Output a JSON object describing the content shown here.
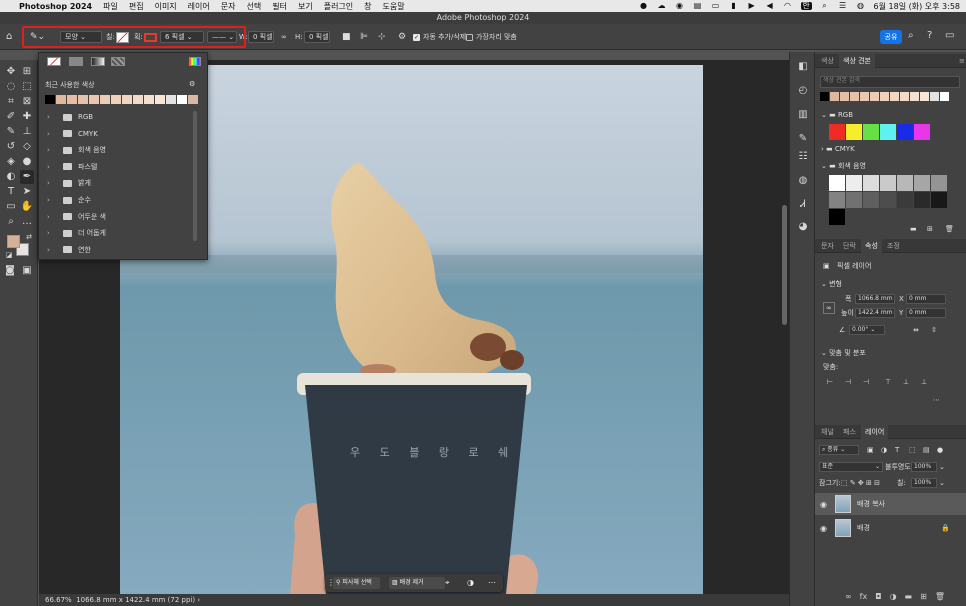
{
  "menubar": {
    "app_name": "Photoshop 2024",
    "items": [
      "파일",
      "편집",
      "이미지",
      "레이어",
      "문자",
      "선택",
      "필터",
      "보기",
      "플러그인",
      "창",
      "도움말"
    ],
    "datetime": "6월 18일 (화) 오후 3:58",
    "input_source": "한"
  },
  "window": {
    "title": "Adobe Photoshop 2024"
  },
  "options": {
    "mode_select": "모양",
    "fill_label": "칠:",
    "stroke_label": "획:",
    "stroke_width": "6 픽셀",
    "w_label": "W:",
    "w_value": "0 픽셀",
    "h_label": "H:",
    "h_value": "0 픽셀",
    "auto_add_delete": "자동 추가/삭제",
    "align_edges": "가장자리 맞춤",
    "share_button": "공유",
    "fill_color": "#ffffff",
    "stroke_color": "#e8392f"
  },
  "swatch_popup": {
    "recent_label": "최근 사용한 색상",
    "recent_colors": [
      "#000000",
      "#e0b8a0",
      "#e4bda4",
      "#e7c2aa",
      "#eac7b0",
      "#edccb6",
      "#efd1bc",
      "#f1d6c2",
      "#f3dbc9",
      "#f5e0cf",
      "#f7e5d6",
      "#e3e3e3",
      "#ffffff",
      "#d8b7a3"
    ],
    "folders": [
      "RGB",
      "CMYK",
      "회색 음영",
      "파스텔",
      "밝게",
      "순수",
      "어두운 색",
      "더 어둡게",
      "연한"
    ]
  },
  "photo": {
    "cup_text": "우 도 블 랑 로 쉐"
  },
  "swatches_panel": {
    "tabs": [
      "색상",
      "색상 견본"
    ],
    "search_placeholder": "색상 견본 검색",
    "groups": [
      "RGB",
      "CMYK",
      "회색 음영"
    ],
    "recent_colors": [
      "#000000",
      "#e0b8a0",
      "#e4bda4",
      "#e7c2aa",
      "#eac7b0",
      "#edccb6",
      "#efd1bc",
      "#f1d6c2",
      "#f3dbc9",
      "#f5e0cf",
      "#f7e5d6",
      "#e3e3e3",
      "#ffffff"
    ],
    "rgb_colors": [
      "#ee2b24",
      "#f5ee2a",
      "#66e044",
      "#5ff0f0",
      "#1a2be8",
      "#e836e8"
    ],
    "gray_colors": [
      "#ffffff",
      "#ededed",
      "#dcdcdc",
      "#cacaca",
      "#b8b8b8",
      "#a6a6a6",
      "#949494",
      "#838383",
      "#717171",
      "#5f5f5f",
      "#4d4d4d",
      "#3b3b3b",
      "#2a2a2a",
      "#181818",
      "#000000"
    ]
  },
  "properties_panel": {
    "tabs": [
      "문자",
      "단락",
      "속성",
      "조정"
    ],
    "layer_type": "픽셀 레이어",
    "transform_label": "변형",
    "w_label": "폭",
    "w_value": "1066.8 mm",
    "x_label": "X",
    "x_value": "0 mm",
    "h_label": "높이",
    "h_value": "1422.4 mm",
    "y_label": "Y",
    "y_value": "0 mm",
    "angle_value": "0.00°",
    "align_label": "맞춤 및 분포",
    "align_sub": "맞춤:"
  },
  "layers_panel": {
    "tabs": [
      "채널",
      "패스",
      "레이어"
    ],
    "filter_label": "종류",
    "blend_mode": "표준",
    "opacity_label": "불투명도:",
    "opacity_value": "100%",
    "lock_label": "잠그기:",
    "fill_label": "칠:",
    "fill_value": "100%",
    "layers": [
      {
        "name": "배경 복사",
        "selected": true
      },
      {
        "name": "배경",
        "selected": false
      }
    ]
  },
  "context_bar": {
    "subject_button": "피사체 선택",
    "remove_bg_button": "배경 제거"
  },
  "status": {
    "zoom": "66.67%",
    "doc_info": "1066.8 mm x 1422.4 mm (72 ppi)"
  }
}
